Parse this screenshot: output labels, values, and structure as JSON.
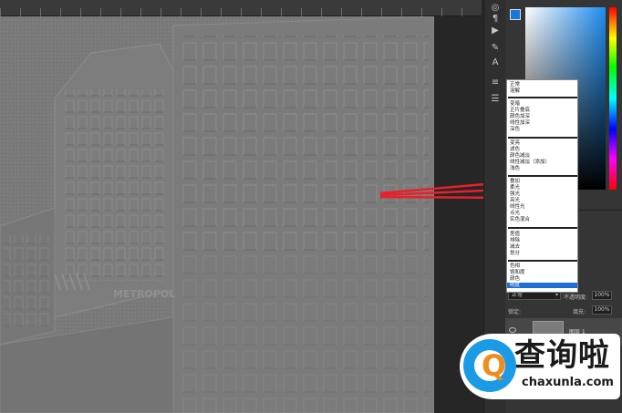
{
  "blend_modes": {
    "groups": [
      [
        "正常",
        "溶解"
      ],
      [
        "变暗",
        "正片叠底",
        "颜色加深",
        "线性加深",
        "深色"
      ],
      [
        "变亮",
        "滤色",
        "颜色减淡",
        "线性减淡（添加）",
        "浅色"
      ],
      [
        "叠加",
        "柔光",
        "强光",
        "亮光",
        "线性光",
        "点光",
        "实色混合"
      ],
      [
        "差值",
        "排除",
        "减去",
        "划分"
      ],
      [
        "色相",
        "饱和度",
        "颜色",
        "明度"
      ]
    ],
    "selected": "明度"
  },
  "layers_panel": {
    "blend_value": "正常",
    "opacity_label": "不透明度:",
    "opacity_value": "100%",
    "lock_label": "锁定:",
    "fill_label": "填充:",
    "fill_value": "100%",
    "layer_name": "图层 1"
  },
  "canvas": {
    "sign_text": "METROPOL"
  },
  "watermark": {
    "logo_letter": "Q",
    "title": "查询啦",
    "url": "chaxunla.com"
  },
  "colors": {
    "selection": "#1d6fd1",
    "watermark_blue": "#1b9ae6",
    "watermark_orange": "#f08c1a",
    "arrow_red": "#e8202a"
  }
}
